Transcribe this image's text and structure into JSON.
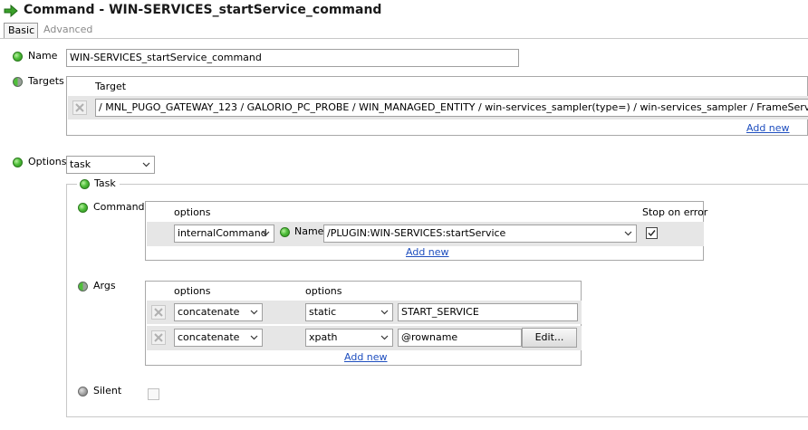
{
  "window": {
    "title": "Command - WIN-SERVICES_startService_command",
    "tabs": [
      {
        "label": "Basic",
        "active": true
      },
      {
        "label": "Advanced",
        "active": false
      }
    ]
  },
  "form": {
    "name_label": "Name",
    "name_value": "WIN-SERVICES_startService_command",
    "targets_label": "Targets",
    "targets_column_header": "Target",
    "target_value": "/ MNL_PUGO_GATEWAY_123 / GALORIO_PC_PROBE / WIN_MANAGED_ENTITY / win-services_sampler(type=) / win-services_sampler / FrameServer / status",
    "targets_add_new": "Add new",
    "options_label": "Options",
    "options_value": "task",
    "task_legend": "Task",
    "commands": {
      "label": "Commands",
      "col_options": "options",
      "col_stop_on_error": "Stop on error",
      "row_option": "internalCommand",
      "name_label": "Name",
      "name_value": "/PLUGIN:WIN-SERVICES:startService",
      "stop_on_error_checked": true,
      "add_new": "Add new"
    },
    "args": {
      "label": "Args",
      "col_options_1": "options",
      "col_options_2": "options",
      "rows": [
        {
          "type": "concatenate",
          "source": "static",
          "value": "START_SERVICE"
        },
        {
          "type": "concatenate",
          "source": "xpath",
          "value": "@rowname",
          "button": "Edit..."
        }
      ],
      "add_new": "Add new"
    },
    "silent_label": "Silent",
    "silent_checked": false
  }
}
